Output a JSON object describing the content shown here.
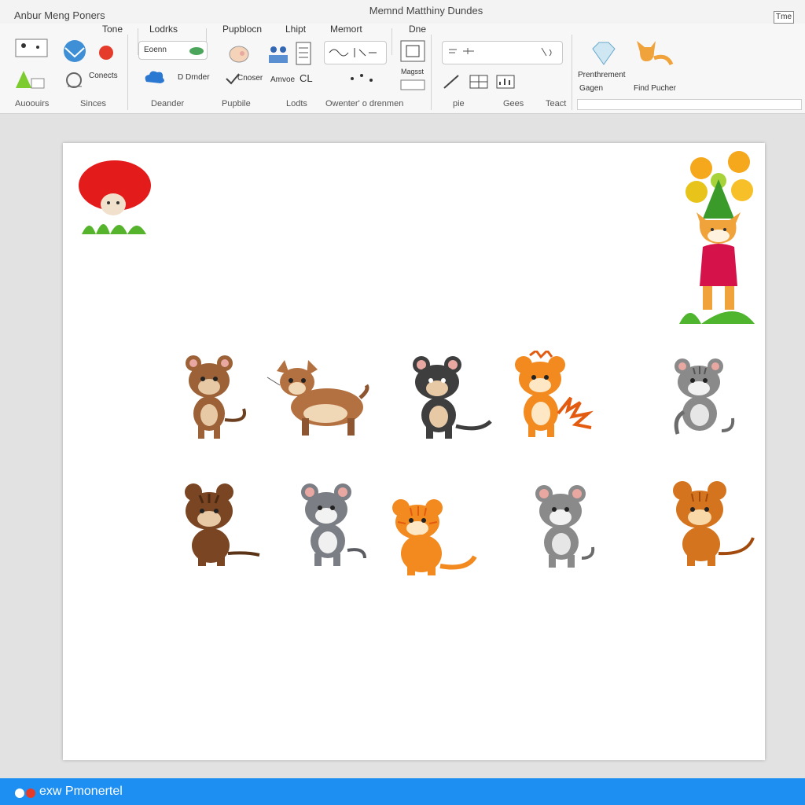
{
  "window": {
    "app_title": "Anbur Meng Poners",
    "doc_title": "Memnd Matthiny Dundes",
    "time_button": "Tme"
  },
  "ribbon": {
    "tabs": [
      "Tone",
      "Lodrks",
      "Pupblocn",
      "Lhipt",
      "Memort",
      "Dne"
    ],
    "groups": [
      "Auoouirs",
      "Sinces",
      "Deander",
      "Pupbile",
      "Lodts",
      "Owenter' o drenmen",
      "pie",
      "Gees",
      "Teact"
    ],
    "search_input": "Eoenn",
    "labels": {
      "conects": "Conects",
      "drunder": "D Drnder",
      "cnoser": "Cnoser",
      "amvoe": "Amvoe",
      "cl": "CL",
      "magsst": "Magsst",
      "prenthrement": "Prenthrement",
      "gagen": "Gagen",
      "find_pucher": "Find Pucher"
    }
  },
  "status": {
    "text": "exw Pmonertel"
  },
  "colors": {
    "accent": "#1e8ff2",
    "ribbon_bg": "#f7f7f7",
    "workspace_bg": "#e2e2e2",
    "page_bg": "#ffffff"
  },
  "clipart": [
    {
      "kind": "mushroom",
      "name": "mushroom-clipart"
    },
    {
      "kind": "flower-fox",
      "name": "flower-fox-clipart"
    },
    {
      "kind": "brown-mouse",
      "name": "brown-mouse-clipart"
    },
    {
      "kind": "brown-dog",
      "name": "brown-dog-clipart"
    },
    {
      "kind": "black-cat",
      "name": "black-cat-clipart"
    },
    {
      "kind": "orange-tiger",
      "name": "orange-tiger-clipart"
    },
    {
      "kind": "grey-cat",
      "name": "grey-cat-clipart"
    },
    {
      "kind": "brown-bear",
      "name": "brown-bear-clipart"
    },
    {
      "kind": "grey-mouse",
      "name": "grey-mouse-clipart"
    },
    {
      "kind": "orange-cat",
      "name": "orange-cat-clipart"
    },
    {
      "kind": "grey-mouse-2",
      "name": "grey-mouse-clipart-2"
    },
    {
      "kind": "orange-bear",
      "name": "orange-bear-clipart"
    }
  ]
}
